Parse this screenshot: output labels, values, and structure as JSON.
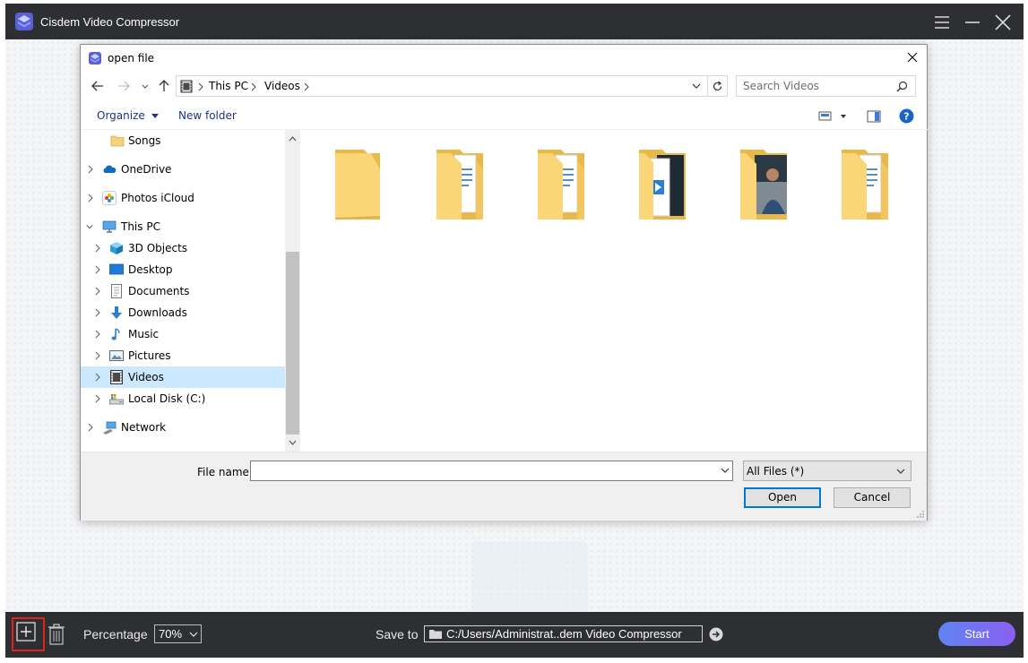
{
  "app": {
    "title": "Cisdem Video Compressor"
  },
  "dialog": {
    "title": "open file",
    "breadcrumb": [
      "This PC",
      "Videos"
    ],
    "search_placeholder": "Search Videos",
    "toolbar": {
      "organize_label": "Organize",
      "new_folder_label": "New folder"
    },
    "tree": [
      {
        "label": "Songs",
        "icon": "folder-icon",
        "selected": false
      },
      {
        "label": "OneDrive",
        "icon": "onedrive-cloud-icon",
        "selected": false
      },
      {
        "label": "Photos iCloud",
        "icon": "photos-icloud-icon",
        "selected": false
      },
      {
        "label": "This PC",
        "icon": "this-pc-icon",
        "selected": false
      },
      {
        "label": "3D Objects",
        "icon": "3d-objects-icon",
        "selected": false
      },
      {
        "label": "Desktop",
        "icon": "desktop-icon",
        "selected": false
      },
      {
        "label": "Documents",
        "icon": "documents-icon",
        "selected": false
      },
      {
        "label": "Downloads",
        "icon": "downloads-icon",
        "selected": false
      },
      {
        "label": "Music",
        "icon": "music-icon",
        "selected": false
      },
      {
        "label": "Pictures",
        "icon": "pictures-icon",
        "selected": false
      },
      {
        "label": "Videos",
        "icon": "videos-icon",
        "selected": true
      },
      {
        "label": "Local Disk (C:)",
        "icon": "local-disk-icon",
        "selected": false
      },
      {
        "label": "Network",
        "icon": "network-icon",
        "selected": false
      }
    ],
    "files": [
      {
        "icon": "empty-folder-icon"
      },
      {
        "icon": "folder-with-documents-icon"
      },
      {
        "icon": "folder-with-documents-icon"
      },
      {
        "icon": "folder-with-video-icon"
      },
      {
        "icon": "folder-with-photo-icon"
      },
      {
        "icon": "folder-with-documents-icon"
      }
    ],
    "file_name_label": "File name:",
    "file_name_value": "",
    "filter_value": "All Files (*)",
    "open_label": "Open",
    "cancel_label": "Cancel"
  },
  "bottombar": {
    "percentage_label": "Percentage",
    "percentage_value": "70%",
    "save_to_label": "Save to",
    "save_path": "C:/Users/Administrat..dem Video Compressor",
    "start_label": "Start"
  },
  "colors": {
    "titlebar_bg": "#2e2f33",
    "highlight_red": "#e0241b",
    "start_gradient_start": "#5f84f0",
    "start_gradient_end": "#8a5ff2",
    "selection_blue": "#cce8ff",
    "link_blue": "#1e3287",
    "primary_button_border": "#0078d7"
  }
}
